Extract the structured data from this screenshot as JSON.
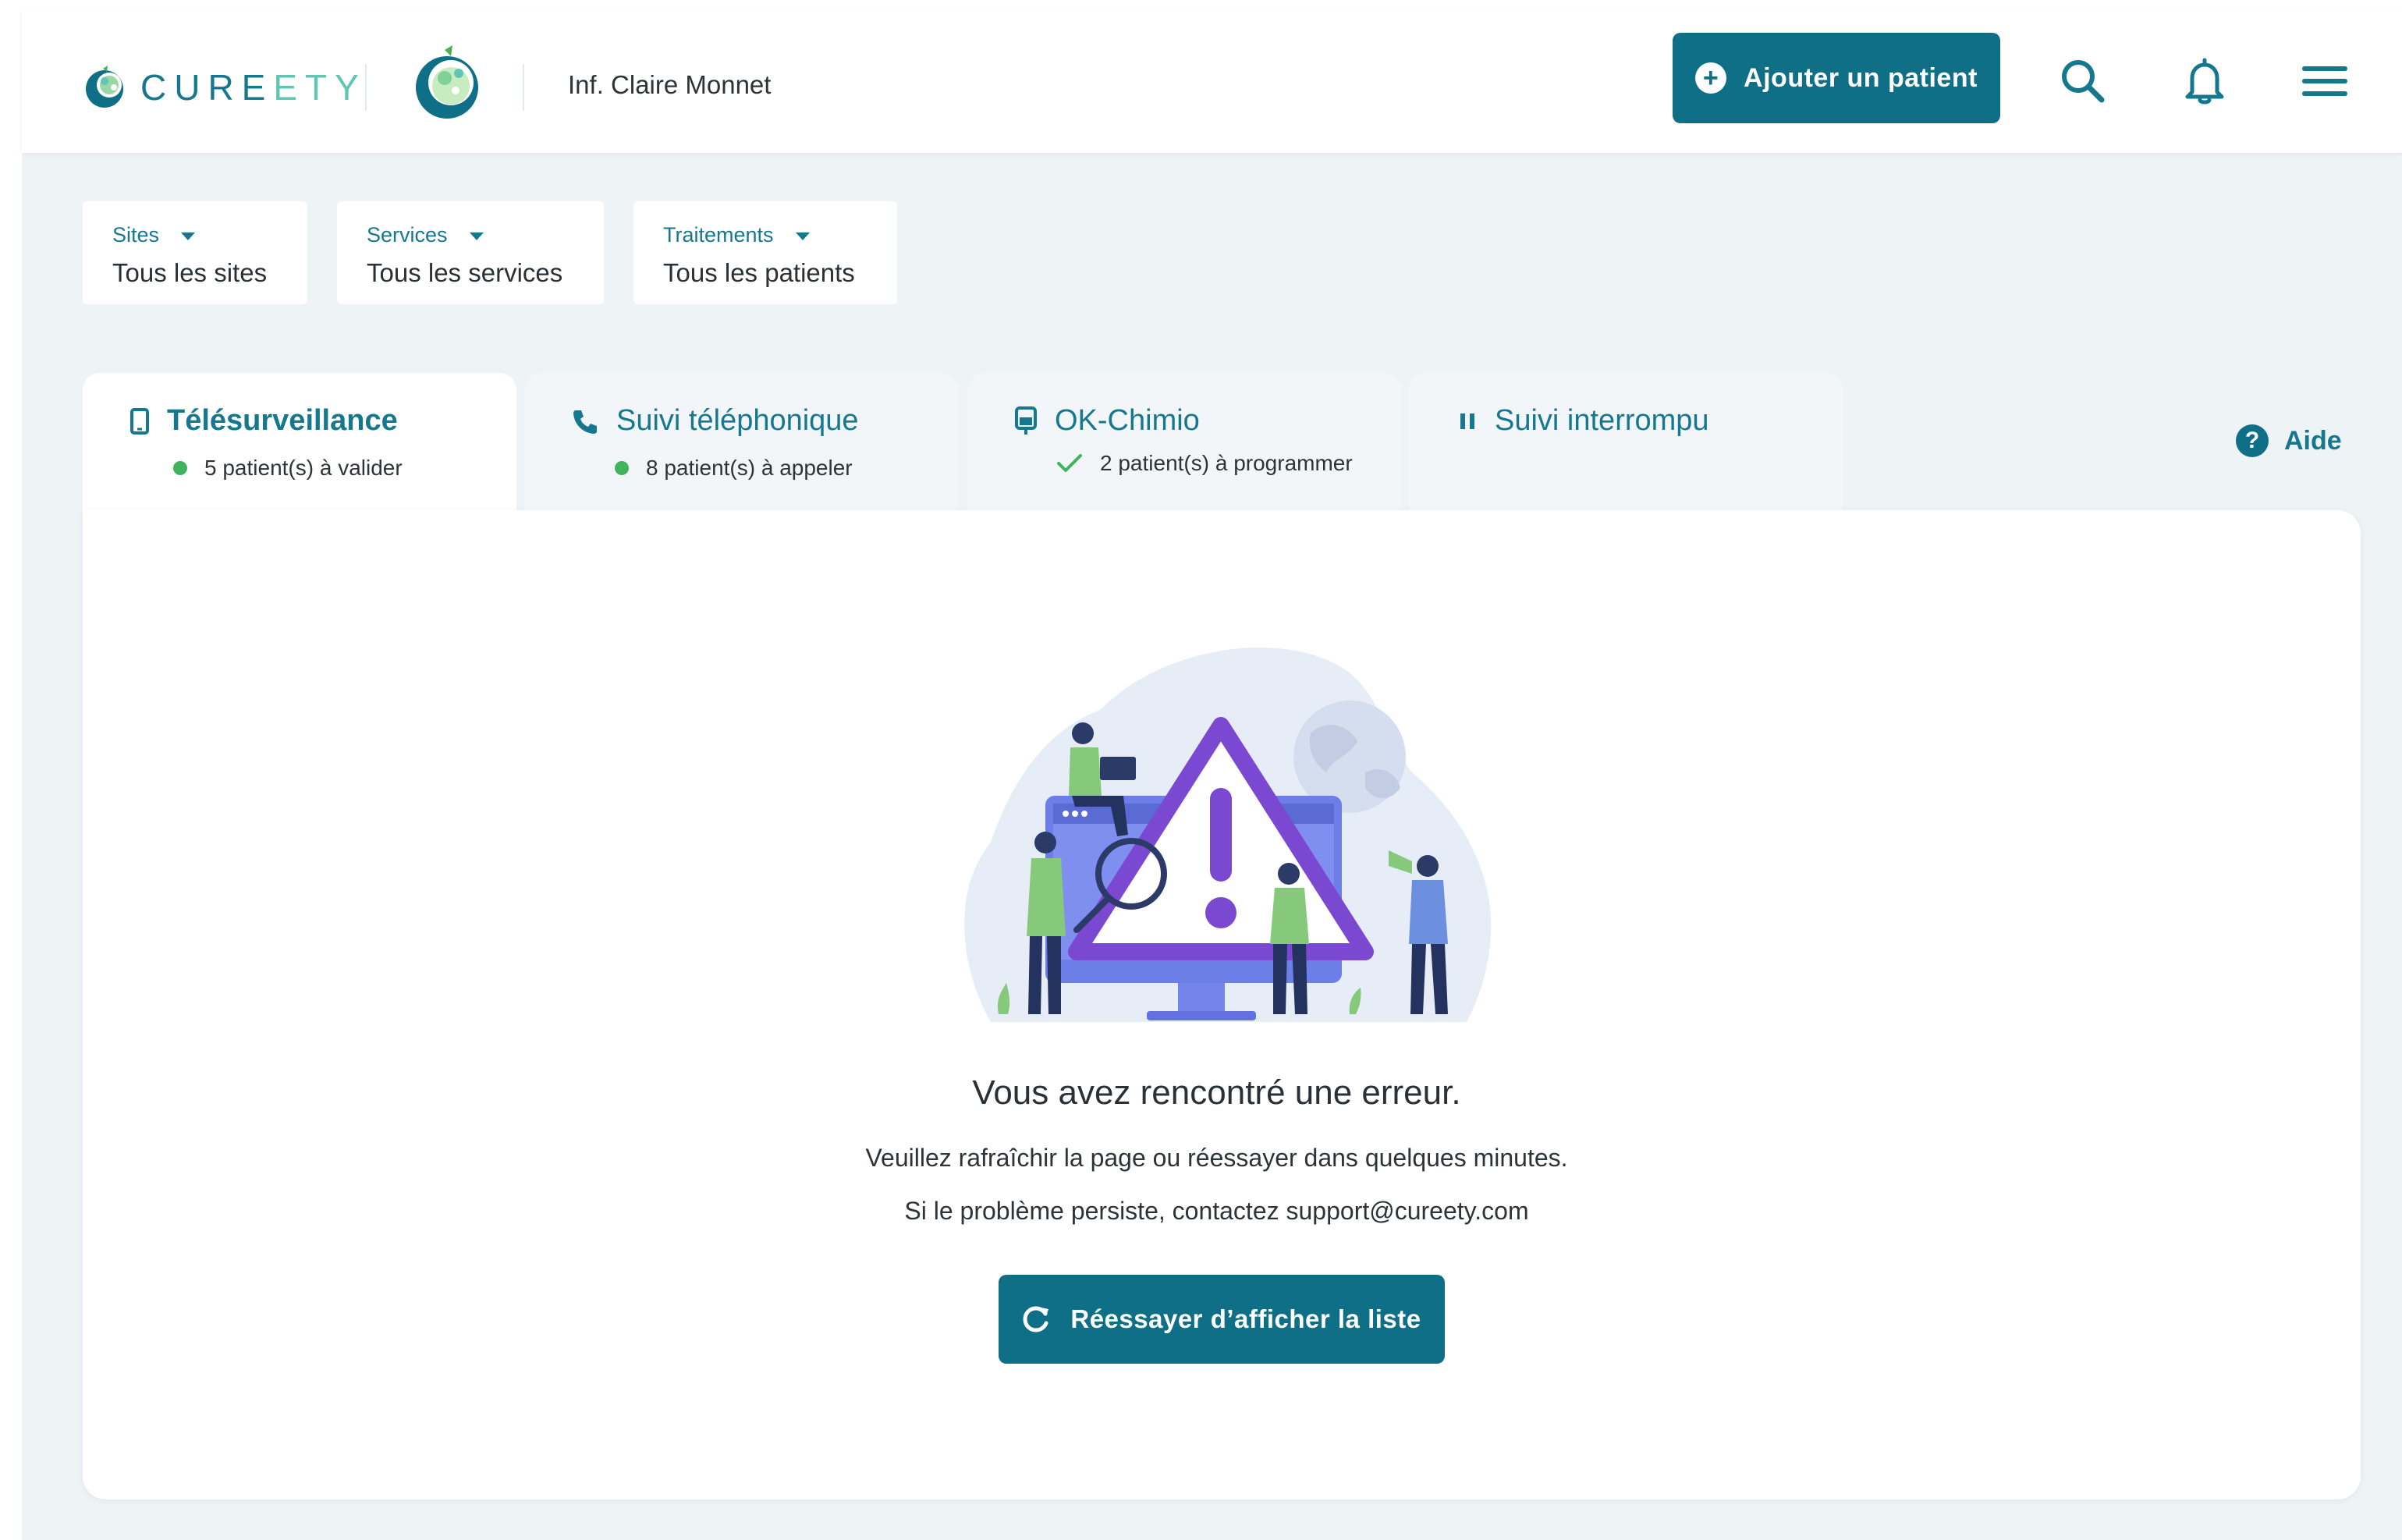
{
  "header": {
    "brand": "CUREETY",
    "user_name": "Inf. Claire Monnet",
    "add_patient_label": "Ajouter un patient",
    "icons": [
      "search-icon",
      "bell-icon",
      "menu-icon"
    ]
  },
  "filters": [
    {
      "label": "Sites",
      "value": "Tous les sites"
    },
    {
      "label": "Services",
      "value": "Tous les services"
    },
    {
      "label": "Traitements",
      "value": "Tous les patients"
    }
  ],
  "tabs": [
    {
      "title": "Télésurveillance",
      "subtitle": "5 patient(s) à valider",
      "icon": "phone-device-icon",
      "active": true
    },
    {
      "title": "Suivi téléphonique",
      "subtitle": "8 patient(s) à appeler",
      "icon": "phone-call-icon",
      "active": false
    },
    {
      "title": "OK-Chimio",
      "subtitle": "2 patient(s) à programmer",
      "icon": "chemo-bag-icon",
      "active": false
    },
    {
      "title": "Suivi interrompu",
      "subtitle": "",
      "icon": "pause-icon",
      "active": false
    }
  ],
  "help_label": "Aide",
  "error": {
    "title": "Vous avez rencontré une erreur.",
    "line1": "Veuillez rafraîchir la page ou réessayer dans quelques minutes.",
    "line2": "Si le problème persiste, contactez support@cureety.com",
    "retry_label": "Réessayer d’afficher la liste"
  },
  "colors": {
    "primary": "#0f6f86",
    "accent_text": "#16788f",
    "status_green": "#3fb45c",
    "background": "#eef3f6"
  }
}
